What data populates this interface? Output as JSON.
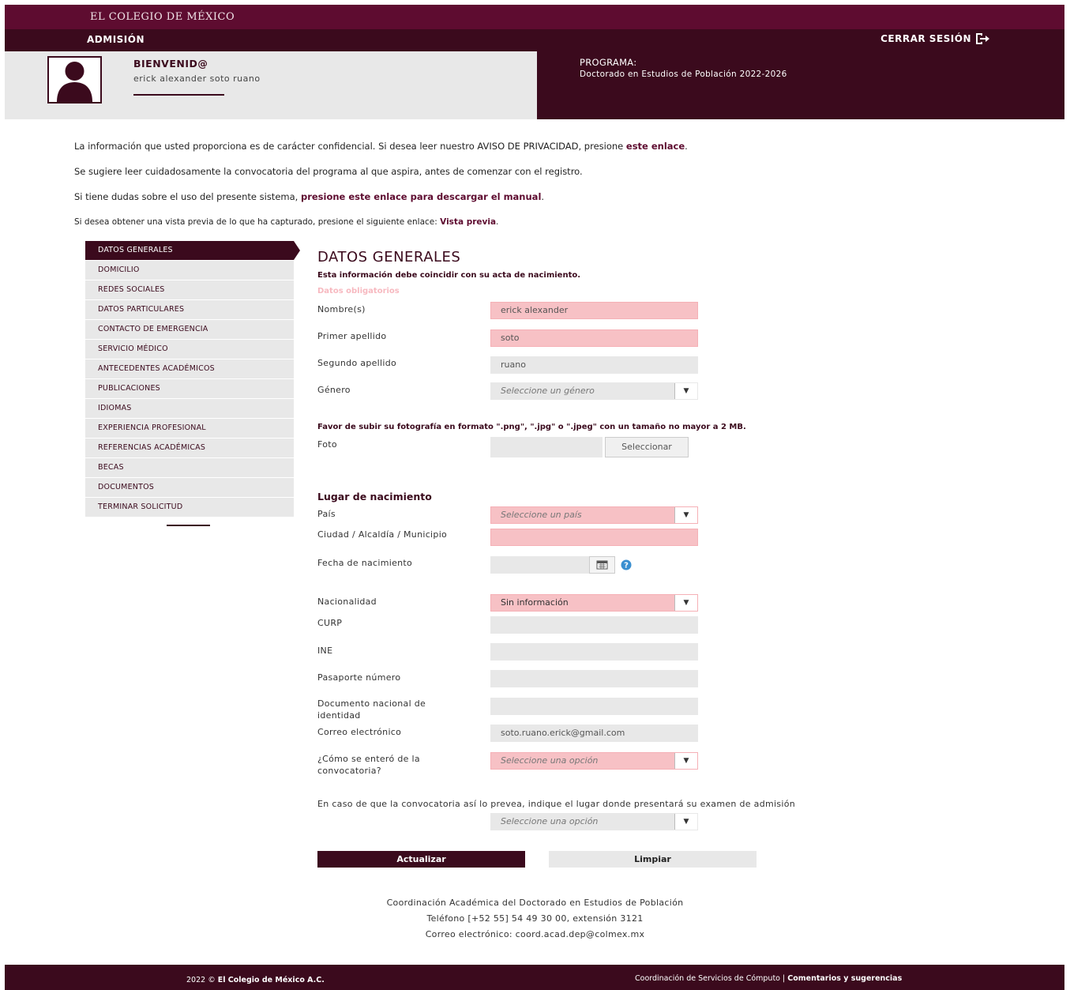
{
  "header": {
    "brand": "EL COLEGIO DE MÉXICO",
    "section": "ADMISIÓN",
    "logout_label": "CERRAR SESIÓN"
  },
  "welcome": {
    "title": "BIENVENID@",
    "user_name": "erick alexander soto ruano"
  },
  "program": {
    "label": "PROGRAMA:",
    "value": "Doctorado en Estudios de Población 2022-2026"
  },
  "notices": {
    "privacy_text": "La información que usted proporciona es de carácter confidencial. Si desea leer nuestro AVISO DE PRIVACIDAD, presione ",
    "privacy_link": "este enlace",
    "read_call": "Se sugiere leer cuidadosamente la convocatoria del programa al que aspira, antes de comenzar con el registro.",
    "manual_text": "Si tiene dudas sobre el uso del presente sistema, ",
    "manual_link": "presione este enlace para descargar el manual",
    "preview_text": "Si desea obtener una vista previa de lo que ha capturado, presione el siguiente enlace: ",
    "preview_link": "Vista previa"
  },
  "sidebar": {
    "items": [
      {
        "label": "DATOS GENERALES"
      },
      {
        "label": "DOMICILIO"
      },
      {
        "label": "REDES SOCIALES"
      },
      {
        "label": "DATOS PARTICULARES"
      },
      {
        "label": "CONTACTO DE EMERGENCIA"
      },
      {
        "label": "SERVICIO MÉDICO"
      },
      {
        "label": "ANTECEDENTES ACADÉMICOS"
      },
      {
        "label": "PUBLICACIONES"
      },
      {
        "label": "IDIOMAS"
      },
      {
        "label": "EXPERIENCIA PROFESIONAL"
      },
      {
        "label": "REFERENCIAS ACADÉMICAS"
      },
      {
        "label": "BECAS"
      },
      {
        "label": "DOCUMENTOS"
      },
      {
        "label": "TERMINAR SOLICITUD"
      }
    ]
  },
  "form": {
    "title": "DATOS GENERALES",
    "subtitle": "Esta información debe coincidir con su acta de nacimiento.",
    "required_note": "Datos obligatorios",
    "nombre_label": "Nombre(s)",
    "nombre_value": "erick alexander",
    "primer_apellido_label": "Primer apellido",
    "primer_apellido_value": "soto",
    "segundo_apellido_label": "Segundo apellido",
    "segundo_apellido_value": "ruano",
    "genero_label": "Género",
    "genero_placeholder": "Seleccione un género",
    "photo_note": "Favor de subir su fotografía en formato \".png\", \".jpg\" o \".jpeg\" con un tamaño no mayor a 2 MB.",
    "foto_label": "Foto",
    "foto_button": "Seleccionar",
    "birthplace_title": "Lugar de nacimiento",
    "pais_label": "País",
    "pais_placeholder": "Seleccione un país",
    "ciudad_label": "Ciudad / Alcaldía / Municipio",
    "fecha_label": "Fecha de nacimiento",
    "nacionalidad_label": "Nacionalidad",
    "nacionalidad_value": "Sin información",
    "curp_label": "CURP",
    "ine_label": "INE",
    "pasaporte_label": "Pasaporte número",
    "documento_label": "Documento nacional de identidad",
    "correo_label": "Correo electrónico",
    "correo_value": "soto.ruano.erick@gmail.com",
    "enterado_label": "¿Cómo se enteró de la convocatoria?",
    "enterado_placeholder": "Seleccione una opción",
    "exam_note": "En caso de que la convocatoria así lo prevea, indique el lugar donde presentará su examen de admisión",
    "exam_placeholder": "Seleccione una opción",
    "update_button": "Actualizar",
    "clear_button": "Limpiar"
  },
  "contact": {
    "line1": "Coordinación Académica del Doctorado en Estudios de Población",
    "line2": "Teléfono [+52 55] 54 49 30 00, extensión 3121",
    "line3": "Correo electrónico: coord.acad.dep@colmex.mx"
  },
  "footer": {
    "copyright": "2022 © ",
    "copyright_org": "El Colegio de México A.C.",
    "services": "Coordinación de Servicios de Cómputo",
    "separator": " | ",
    "feedback_link": "Comentarios y sugerencias"
  }
}
